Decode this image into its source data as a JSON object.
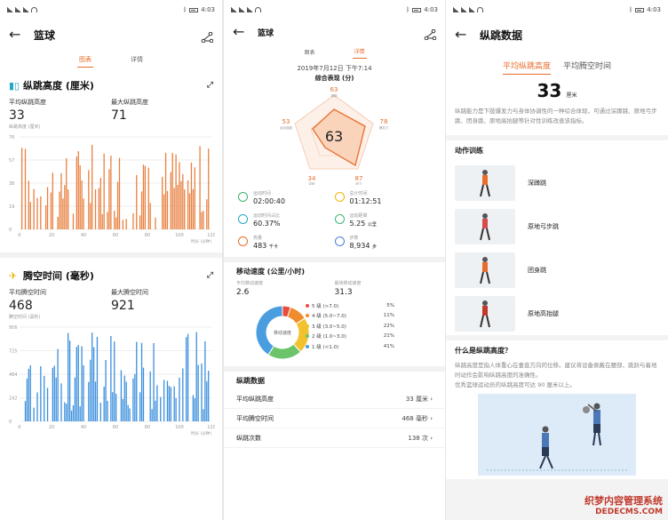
{
  "status": {
    "time": "4:03",
    "time_s2": "4:03"
  },
  "s1": {
    "title": "篮球",
    "tabs": [
      "图表",
      "详情"
    ],
    "jump": {
      "title": "纵跳高度 (厘米)",
      "avg_label": "平均纵跳高度",
      "avg_value": "33",
      "max_label": "最大纵跳高度",
      "max_value": "71",
      "sub_label": "纵跳高度 (厘米)",
      "y_ticks": [
        "76",
        "57",
        "38",
        "19",
        "0"
      ],
      "x_ticks": [
        "0",
        "20",
        "40",
        "60",
        "80",
        "100",
        "120"
      ],
      "x_unit": "时长 (分钟)"
    },
    "air": {
      "title": "腾空时间 (毫秒)",
      "avg_label": "平均腾空时间",
      "avg_value": "468",
      "max_label": "最大腾空时间",
      "max_value": "921",
      "sub_label": "腾空时间 (毫秒)",
      "y_ticks": [
        "956",
        "725",
        "484",
        "242",
        "0"
      ],
      "x_ticks": [
        "0",
        "20",
        "40",
        "60",
        "80",
        "100",
        "120"
      ],
      "x_unit": "时长 (分钟)"
    }
  },
  "s2": {
    "title": "篮球",
    "tabs": [
      "图表",
      "详情"
    ],
    "date": "2019年7月12日 下午7:14",
    "score_title": "综合表现 (分)",
    "score": "63",
    "radar": [
      {
        "label": "弹跳",
        "value": "63"
      },
      {
        "label": "爆发力",
        "value": "78"
      },
      {
        "label": "耐力",
        "value": "87"
      },
      {
        "label": "突破",
        "value": "34"
      },
      {
        "label": "运动强度",
        "value": "53"
      }
    ],
    "grid": [
      {
        "label": "运动时间",
        "value": "02:00:40",
        "unit": "",
        "color": "#3cb371"
      },
      {
        "label": "总计时间",
        "value": "01:12:51",
        "unit": "",
        "color": "#f0b400"
      },
      {
        "label": "运动时间占比",
        "value": "60.37%",
        "unit": "",
        "color": "#2aa7c9"
      },
      {
        "label": "运动距离",
        "value": "5.25",
        "unit": "公里",
        "color": "#3cb371"
      },
      {
        "label": "热量",
        "value": "483",
        "unit": "千卡",
        "color": "#e86d2b"
      },
      {
        "label": "步数",
        "value": "8,934",
        "unit": "步",
        "color": "#4a7fd6"
      }
    ],
    "speed": {
      "title": "移动速度 (公里/小时)",
      "avg_label": "平均移动速度",
      "avg_value": "2.6",
      "max_label": "最快移动速度",
      "max_value": "31.3",
      "donut_label": "移动速度",
      "zones": [
        {
          "label": "5 级 (>7.0)",
          "pct": "5%",
          "value": 5,
          "color": "#e84c3d"
        },
        {
          "label": "4 级 (5.0~7.0)",
          "pct": "11%",
          "value": 11,
          "color": "#f08c2e"
        },
        {
          "label": "3 级 (3.0~5.0)",
          "pct": "22%",
          "value": 22,
          "color": "#f2c12e"
        },
        {
          "label": "2 级 (1.0~3.0)",
          "pct": "21%",
          "value": 21,
          "color": "#6cc46a"
        },
        {
          "label": "1 级 (<1.0)",
          "pct": "41%",
          "value": 41,
          "color": "#4a9ee0"
        }
      ]
    },
    "jump_section": {
      "title": "纵跳数据",
      "rows": [
        {
          "label": "平均纵跳高度",
          "value": "33 厘米"
        },
        {
          "label": "平均腾空时间",
          "value": "468 毫秒"
        },
        {
          "label": "纵跳次数",
          "value": "138 次"
        }
      ]
    }
  },
  "s3": {
    "title": "纵跳数据",
    "tabs": [
      "平均纵跳高度",
      "平均腾空时间"
    ],
    "value": "33",
    "unit": "厘米",
    "desc": "纵跳能力是下肢爆发力与身体协调性的一种综合体现，可通过深蹲跳、原地弓步跳、团身跳、原地高抬腿等针对性训练改善该指标。",
    "training_title": "动作训练",
    "exercises": [
      "深蹲跳",
      "原地弓步跳",
      "团身跳",
      "原地高抬腿"
    ],
    "what_title": "什么是纵跳高度？",
    "what_desc": "纵跳高度是指人体重心在垂直方向的位移。建议将设备佩戴在腰部，跳跃与着地时动作会影响纵跳高度的准确性。",
    "what_desc2": "优秀篮球运动员的纵跳高度可达 90 厘米以上。",
    "watermark": "织梦内容管理系统",
    "watermark2": "DEDECMS.COM"
  },
  "colors": {
    "accent": "#e86d2b",
    "blue": "#2a86d6",
    "teal": "#2aa7c9"
  }
}
